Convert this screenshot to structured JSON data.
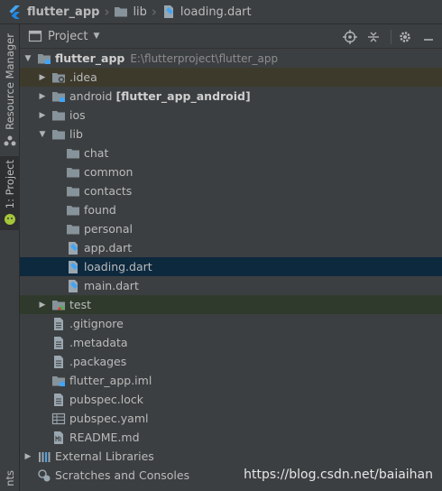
{
  "breadcrumb": [
    {
      "label": "flutter_app",
      "icon": "flutter-icon"
    },
    {
      "label": "lib",
      "icon": "folder-icon"
    },
    {
      "label": "loading.dart",
      "icon": "dart-file-icon"
    }
  ],
  "side_tabs": {
    "resource_manager": "Resource Manager",
    "project": "1: Project",
    "bottom_partial": "nts"
  },
  "panel": {
    "title": "Project",
    "tools": [
      "locate-icon",
      "collapse-all-icon",
      "settings-gear-icon",
      "hide-panel-icon"
    ]
  },
  "tree": {
    "root": {
      "label": "flutter_app",
      "path": "E:\\flutterproject\\flutter_app"
    },
    "idea": ".idea",
    "android": {
      "label": "android",
      "module": "[flutter_app_android]"
    },
    "ios": "ios",
    "lib": "lib",
    "lib_children": [
      "chat",
      "common",
      "contacts",
      "found",
      "personal"
    ],
    "lib_files": [
      "app.dart",
      "loading.dart",
      "main.dart"
    ],
    "test": "test",
    "files": [
      ".gitignore",
      ".metadata",
      ".packages",
      "flutter_app.iml",
      "pubspec.lock",
      "pubspec.yaml",
      "README.md"
    ],
    "external_libraries": "External Libraries",
    "scratches": "Scratches and Consoles"
  },
  "selected_item": "loading.dart",
  "watermark": "https://blog.csdn.net/baiaihan",
  "colors": {
    "background": "#3c3f41",
    "selection": "#0d293e",
    "folder": "#87939a",
    "flutter_blue": "#42a5f5"
  }
}
